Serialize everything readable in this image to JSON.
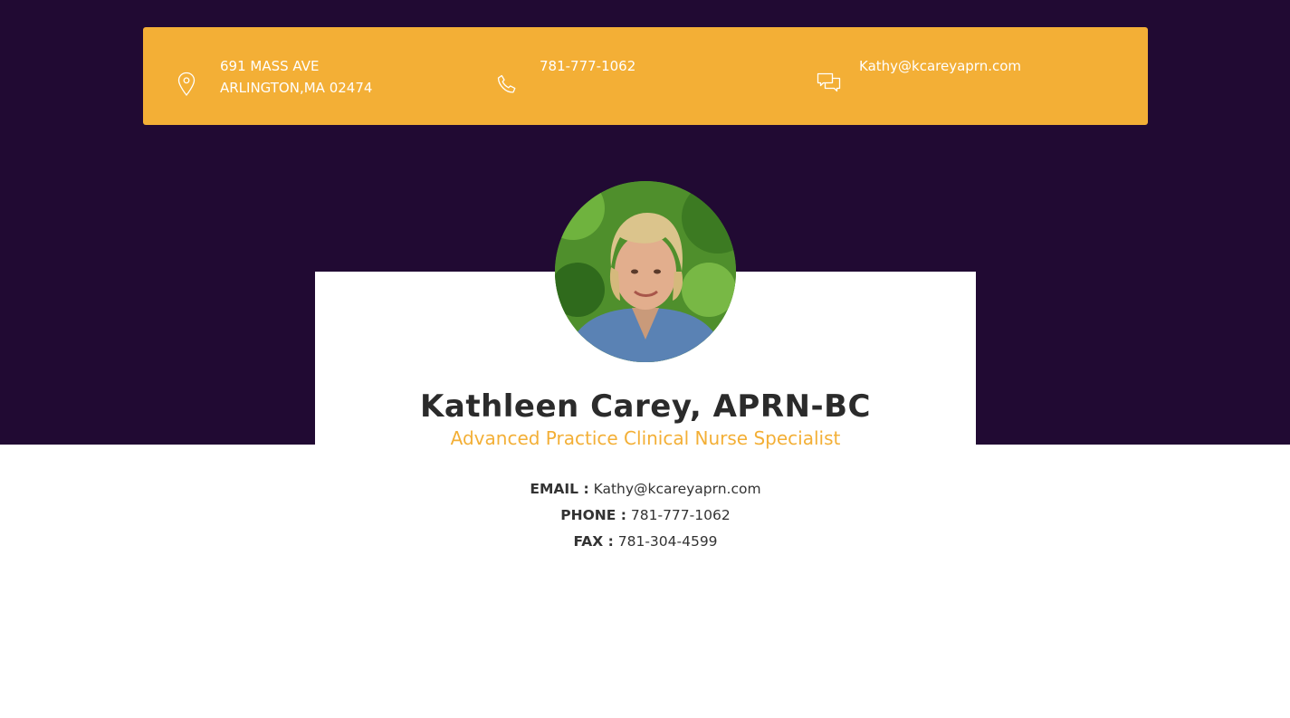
{
  "contact_bar": {
    "address_line1": "691 MASS AVE",
    "address_line2": "ARLINGTON,MA 02474",
    "phone": "781-777-1062",
    "email": "Kathy@kcareyaprn.com",
    "icons": [
      "map-pin-icon",
      "phone-icon",
      "chat-icon"
    ]
  },
  "profile": {
    "name": "Kathleen Carey, APRN-BC",
    "title": "Advanced Practice Clinical Nurse Specialist",
    "email_label": "EMAIL :",
    "email_value": "Kathy@kcareyaprn.com",
    "phone_label": "PHONE :",
    "phone_value": "781-777-1062",
    "fax_label": "FAX :",
    "fax_value": "781-304-4599"
  },
  "colors": {
    "hero_background": "#210a33",
    "accent": "#f3af36",
    "text_dark": "#2b2b2b"
  }
}
